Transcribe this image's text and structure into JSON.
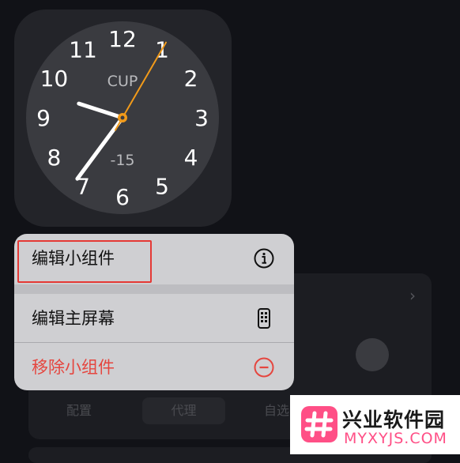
{
  "clock": {
    "city": "CUP",
    "offset": "-15",
    "numerals": [
      "12",
      "1",
      "2",
      "3",
      "4",
      "5",
      "6",
      "7",
      "8",
      "9",
      "10",
      "11"
    ],
    "time": {
      "hour": 9,
      "minute": 36,
      "second": 5
    }
  },
  "background": {
    "tabs": [
      "配置",
      "代理",
      "自选"
    ]
  },
  "menu": {
    "items": [
      {
        "label": "编辑小组件",
        "icon": "info-icon"
      },
      {
        "label": "编辑主屏幕",
        "icon": "phone-icon"
      },
      {
        "label": "移除小组件",
        "icon": "minus-circle-icon"
      }
    ]
  },
  "colors": {
    "remove_red": "#e5463f",
    "second_hand": "#f19a1a",
    "highlight": "#e53935"
  },
  "watermark": {
    "title": "兴业软件园",
    "url": "MYXYJS.COM"
  }
}
